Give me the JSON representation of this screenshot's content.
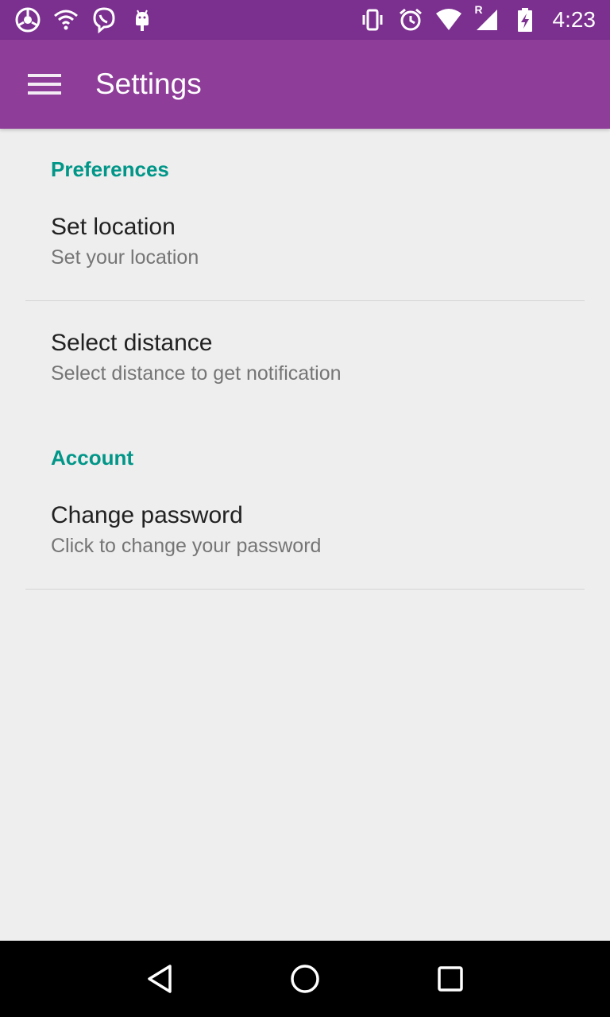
{
  "status_bar": {
    "time": "4:23",
    "left_icons": [
      "app-circle-icon",
      "wifi-icon",
      "viber-icon",
      "android-icon"
    ],
    "right_icons": [
      "vibrate-icon",
      "alarm-icon",
      "wifi-signal-icon",
      "cell-signal-icon",
      "battery-charging-icon"
    ],
    "roaming_indicator": "R"
  },
  "app_bar": {
    "title": "Settings",
    "background": "#8e3d99",
    "status_background": "#7b2f8f"
  },
  "sections": [
    {
      "header": "Preferences",
      "items": [
        {
          "title": "Set location",
          "summary": "Set your location"
        },
        {
          "title": "Select distance",
          "summary": "Select distance to get notification"
        }
      ]
    },
    {
      "header": "Account",
      "items": [
        {
          "title": "Change password",
          "summary": "Click to change your password"
        }
      ]
    }
  ],
  "colors": {
    "accent": "#009688",
    "primary_text": "#212121",
    "secondary_text": "#757575",
    "background": "#eeeeee"
  },
  "nav_bar": {
    "buttons": [
      "back-icon",
      "home-icon",
      "recents-icon"
    ]
  }
}
